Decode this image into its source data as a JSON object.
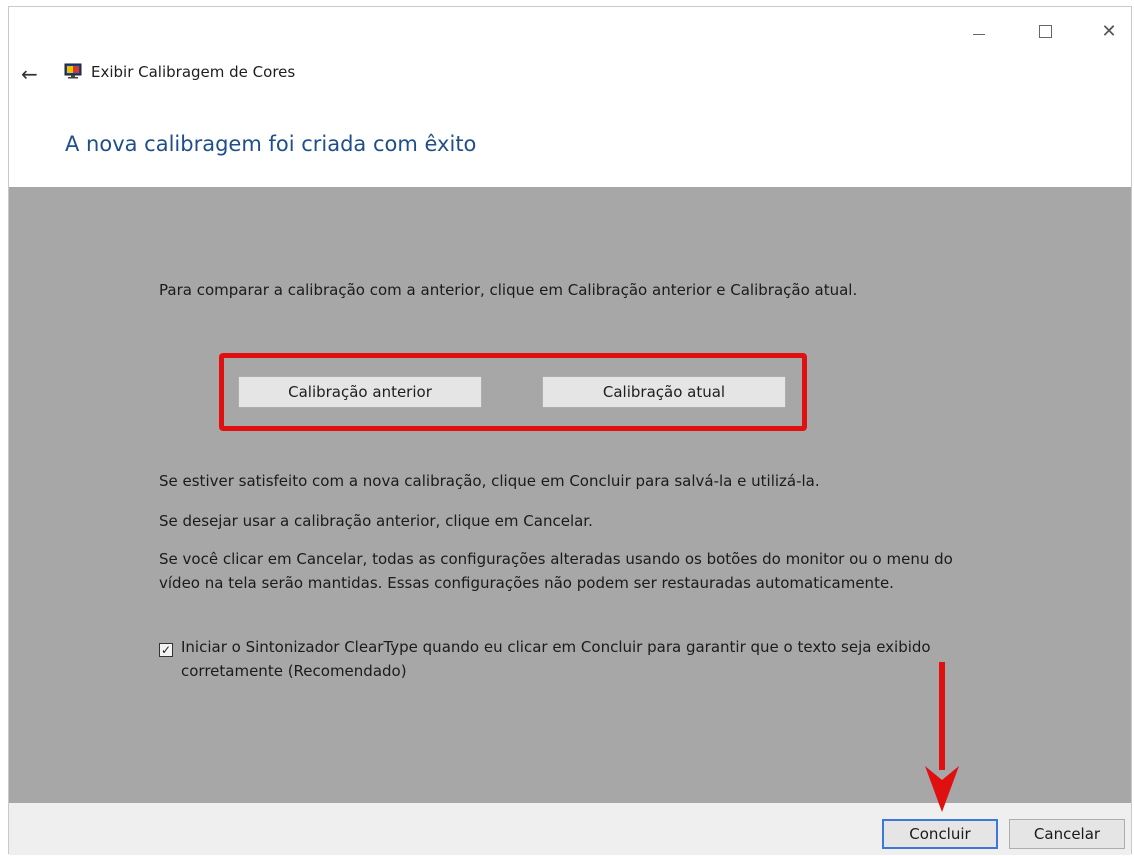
{
  "window": {
    "title": "Exibir Calibragem de Cores",
    "controls": {
      "minimize": "minimize-icon",
      "maximize": "maximize-icon",
      "close": "close-icon"
    }
  },
  "heading": "A nova calibragem foi criada com êxito",
  "content": {
    "compare_text": "Para comparar a calibração com a anterior, clique em Calibração anterior e Calibração atual.",
    "btn_previous": "Calibração anterior",
    "btn_current": "Calibração atual",
    "satisfied_text": "Se estiver satisfeito com a nova calibração, clique em Concluir para salvá-la e utilizá-la.",
    "cancel_text": "Se desejar usar a calibração anterior, clique em Cancelar.",
    "warning_text": "Se você clicar em Cancelar, todas as configurações alteradas usando os botões do monitor ou o menu do vídeo na tela serão mantidas. Essas configurações não podem ser restauradas automaticamente.",
    "cleartype_label": "Iniciar o Sintonizador ClearType quando eu clicar em Concluir para garantir que o texto seja exibido corretamente (Recomendado)",
    "cleartype_checked": true
  },
  "footer": {
    "finish": "Concluir",
    "cancel": "Cancelar"
  },
  "colors": {
    "heading": "#1f4e8c",
    "content_bg": "#a7a7a7",
    "highlight": "#e01010",
    "accent": "#3b78d8"
  }
}
